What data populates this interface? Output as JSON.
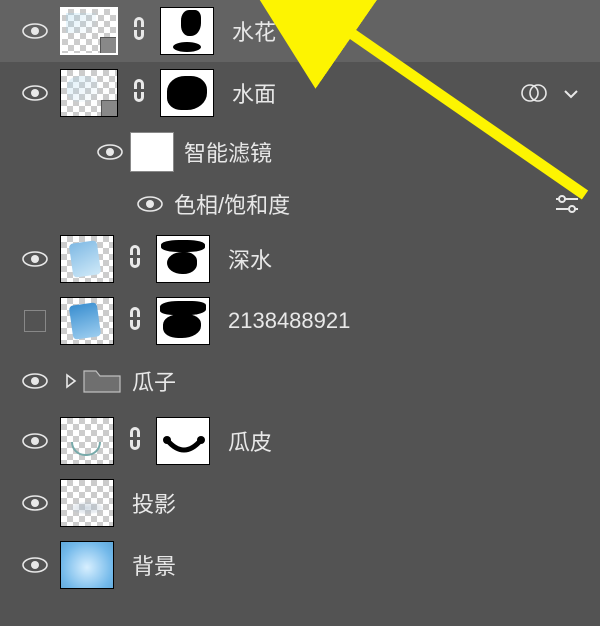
{
  "colors": {
    "panel_bg": "#535353",
    "selected_bg": "#636363",
    "text": "#e8e8e8",
    "arrow": "#fdf401"
  },
  "layers": [
    {
      "id": "splash",
      "name": "水花",
      "visible": true,
      "selected": true,
      "linked": true,
      "has_mask": true,
      "smart": true
    },
    {
      "id": "surface",
      "name": "水面",
      "visible": true,
      "linked": true,
      "has_mask": true,
      "smart": true,
      "expanded": true,
      "has_filter": true,
      "blend_icon": "overlap-circles"
    },
    {
      "id": "sf_filter_group",
      "name": "智能滤镜",
      "visible": true
    },
    {
      "id": "sf_filter_hs",
      "name": "色相/饱和度",
      "visible": true
    },
    {
      "id": "deep",
      "name": "深水",
      "visible": true,
      "linked": true,
      "has_mask": true
    },
    {
      "id": "num",
      "name": "2138488921",
      "visible": false,
      "linked": true,
      "has_mask": true
    },
    {
      "id": "seeds",
      "name": "瓜子",
      "visible": true,
      "is_group": true
    },
    {
      "id": "rind",
      "name": "瓜皮",
      "visible": true,
      "linked": true,
      "has_mask": true
    },
    {
      "id": "shadow",
      "name": "投影",
      "visible": true
    },
    {
      "id": "bg",
      "name": "背景",
      "visible": true
    }
  ]
}
